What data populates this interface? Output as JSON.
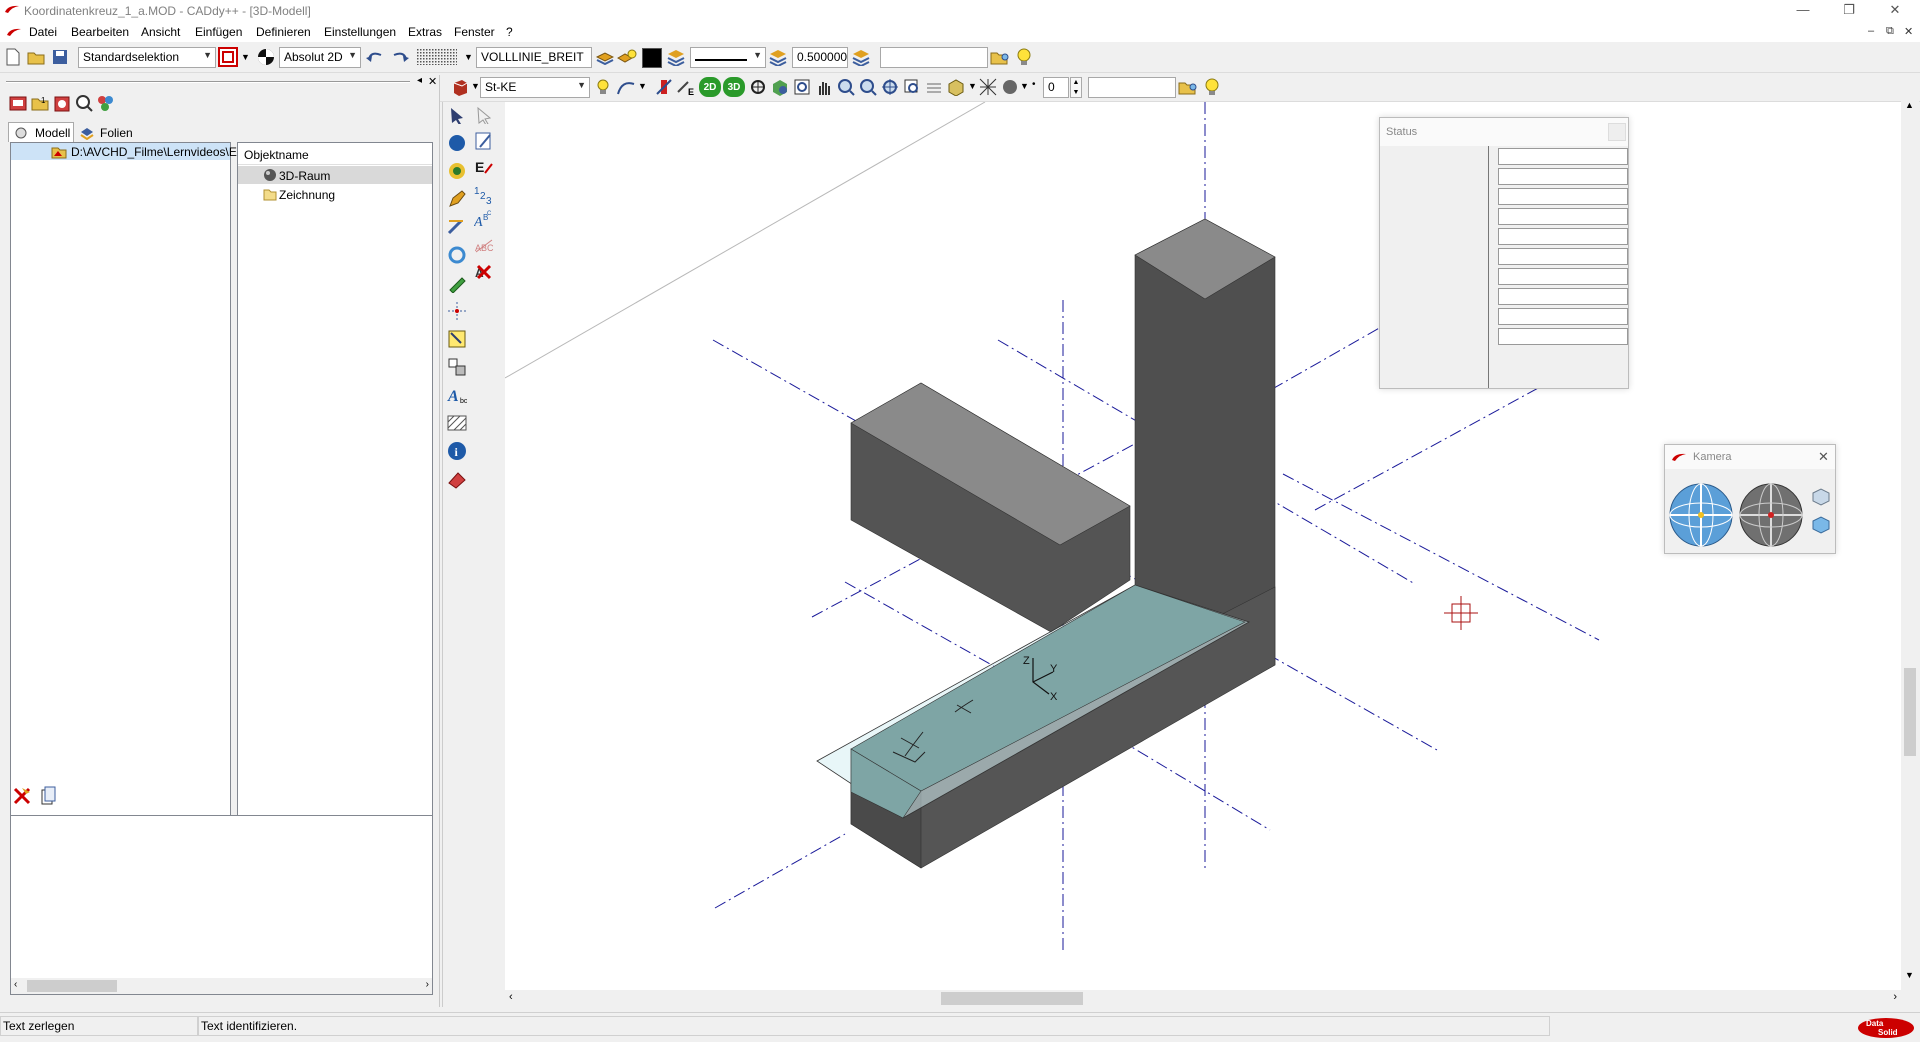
{
  "window": {
    "title": "Koordinatenkreuz_1_a.MOD  -  CADdy++ - [3D-Modell]",
    "controls": {
      "minimize": "—",
      "restore": "❐",
      "close": "✕"
    }
  },
  "menu": {
    "items": [
      "Datei",
      "Bearbeiten",
      "Ansicht",
      "Einfügen",
      "Definieren",
      "Einstellungen",
      "Extras",
      "Fenster",
      "?"
    ],
    "mdi_controls": {
      "minimize": "–",
      "restore": "⧉",
      "close": "✕"
    }
  },
  "toolbar1": {
    "selection_mode": "Standardselektion",
    "coord_mode": "Absolut 2D",
    "line_type": "VOLLLINIE_BREIT",
    "line_width": "0.500000",
    "text_field": ""
  },
  "toolbar2": {
    "material": "St-KE",
    "counter_value": "0",
    "text_field": ""
  },
  "left_panel": {
    "tabs": [
      "Modell",
      "Folien"
    ],
    "tree_path": "D:\\AVCHD_Filme\\Lernvideos\\E",
    "object_header": "Objektname",
    "objects": [
      "3D-Raum",
      "Zeichnung"
    ]
  },
  "status_window": {
    "title": "Status"
  },
  "camera_window": {
    "title": "Kamera",
    "close": "✕"
  },
  "statusbar": {
    "left": "Text zerlegen",
    "middle": "Text identifizieren."
  },
  "brand": {
    "logo_text": "Data Solid",
    "accent": "#cc0000"
  },
  "colors": {
    "accent_red": "#cc0000",
    "dark_block": "#545454",
    "block_top": "#8a8a8a",
    "glass": "#7ea5a5",
    "axis_blue": "#1a1a9a"
  }
}
